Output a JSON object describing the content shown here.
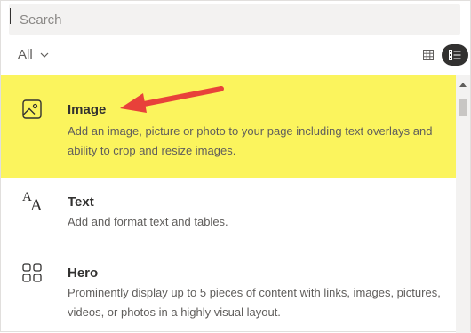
{
  "search": {
    "placeholder": "Search",
    "value": ""
  },
  "filter": {
    "label": "All"
  },
  "views": {
    "grid_icon": "grid-view-icon",
    "list_icon": "list-view-icon",
    "active": "list"
  },
  "items": [
    {
      "title": "Image",
      "description": "Add an image, picture or photo to your page including text overlays and ability to crop and resize images.",
      "icon": "image-icon",
      "highlighted": true
    },
    {
      "title": "Text",
      "description": "Add and format text and tables.",
      "icon": "text-icon"
    },
    {
      "title": "Hero",
      "description": "Prominently display up to 5 pieces of content with links, images, pictures, videos, or photos in a highly visual layout.",
      "icon": "hero-layout-icon"
    }
  ],
  "colors": {
    "highlight": "#fbf45d",
    "arrow": "#e8413a",
    "accent": "#323130"
  }
}
